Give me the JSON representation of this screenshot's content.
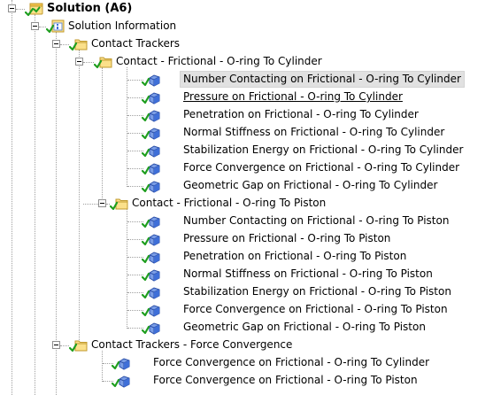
{
  "tree": {
    "root": {
      "label": "Solution (A6)"
    },
    "solution_information": {
      "label": "Solution Information"
    },
    "contact_trackers": {
      "label": "Contact Trackers"
    },
    "cylinder_group": {
      "label": "Contact - Frictional - O-ring To Cylinder"
    },
    "cylinder_items": [
      {
        "label": "Number Contacting on Frictional - O-ring To Cylinder"
      },
      {
        "label": "Pressure on Frictional - O-ring To Cylinder"
      },
      {
        "label": "Penetration on Frictional - O-ring To Cylinder"
      },
      {
        "label": "Normal Stiffness on Frictional - O-ring To Cylinder"
      },
      {
        "label": "Stabilization Energy on Frictional - O-ring To Cylinder"
      },
      {
        "label": "Force Convergence on Frictional - O-ring To Cylinder"
      },
      {
        "label": "Geometric Gap on Frictional - O-ring To Cylinder"
      }
    ],
    "piston_group": {
      "label": "Contact - Frictional - O-ring To Piston"
    },
    "piston_items": [
      {
        "label": "Number Contacting on Frictional - O-ring To Piston"
      },
      {
        "label": "Pressure on Frictional - O-ring To Piston"
      },
      {
        "label": "Penetration on Frictional - O-ring To Piston"
      },
      {
        "label": "Normal Stiffness on Frictional - O-ring To Piston"
      },
      {
        "label": "Stabilization Energy on Frictional - O-ring To Piston"
      },
      {
        "label": "Force Convergence on Frictional - O-ring To Piston"
      },
      {
        "label": "Geometric Gap on Frictional - O-ring To Piston"
      }
    ],
    "force_convergence_group": {
      "label": "Contact Trackers - Force Convergence"
    },
    "force_convergence_items": [
      {
        "label": "Force Convergence on Frictional - O-ring To Cylinder"
      },
      {
        "label": "Force Convergence on Frictional - O-ring To Piston"
      }
    ]
  },
  "colors": {
    "check_green": "#1f9e1f",
    "folder_fill": "#fbe08a",
    "folder_edge": "#c19a2e",
    "tracker_blue": "#3f6fd8",
    "selection_bg": "#e1e1e1",
    "tree_lines": "#a0a0a0"
  },
  "icons": {
    "expander": "minus-box-icon",
    "solution": "solution-icon",
    "solution_information": "solution-information-icon",
    "folder": "folder-icon",
    "tracker": "contact-tracker-icon",
    "status": "green-check-icon"
  }
}
